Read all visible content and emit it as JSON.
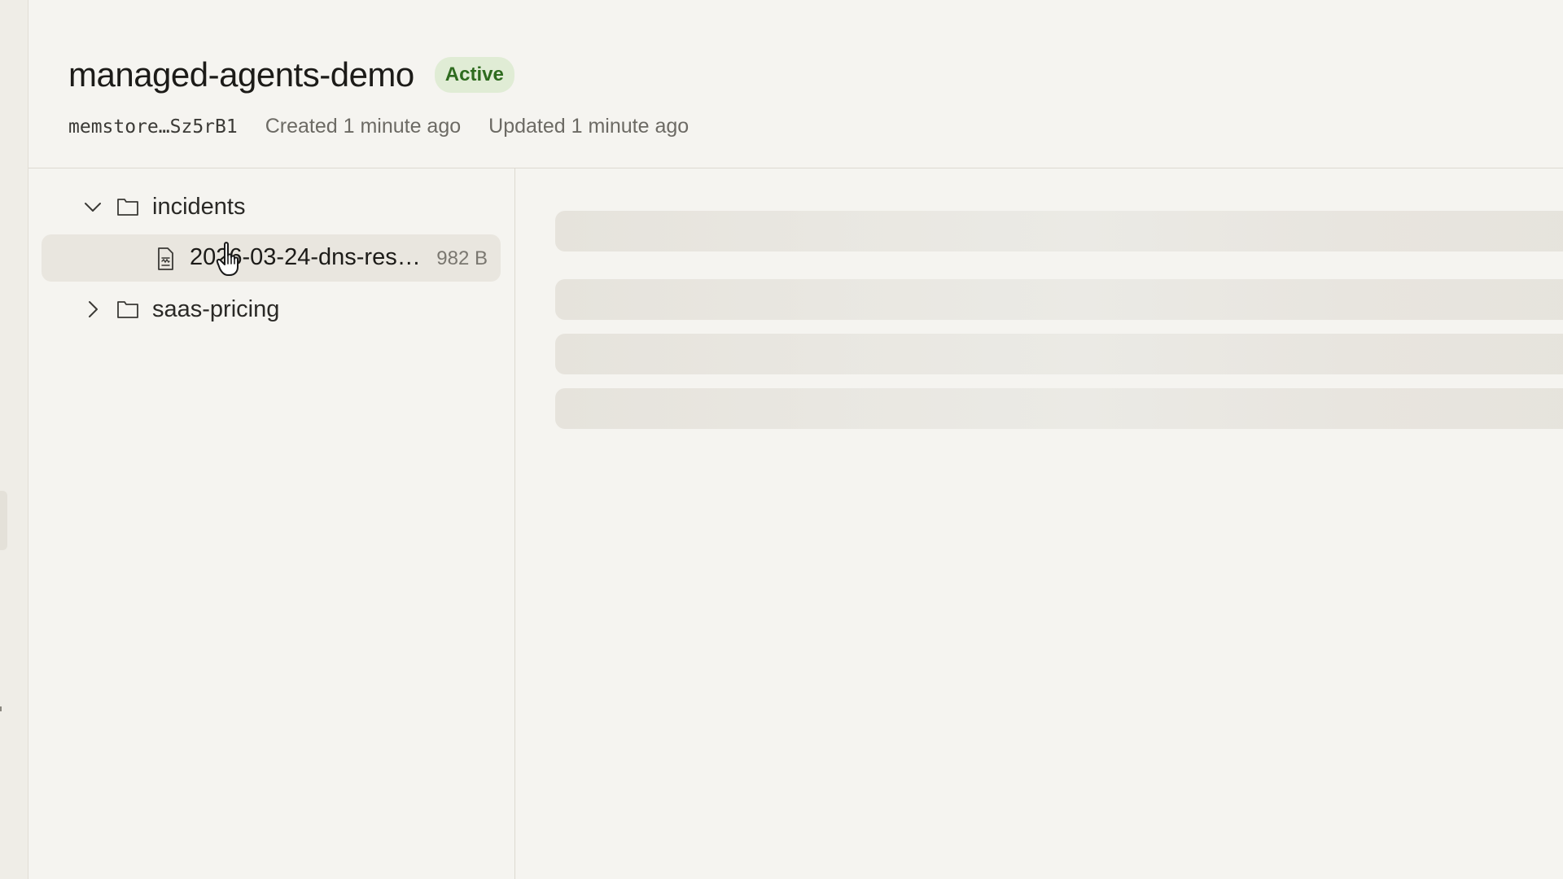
{
  "header": {
    "title": "managed-agents-demo",
    "status": "Active",
    "store_id": "memstore…Sz5rB1",
    "created": "Created 1 minute ago",
    "updated": "Updated 1 minute ago"
  },
  "tree": {
    "folders": [
      {
        "label": "incidents",
        "expanded": true,
        "icon": "folder-icon"
      },
      {
        "label": "saas-pricing",
        "expanded": false,
        "icon": "folder-icon"
      }
    ],
    "file": {
      "label": "2026-03-24-dns-res…",
      "size": "982 B",
      "icon": "document-icon"
    }
  },
  "content": {
    "state": "loading",
    "skeleton_rows": 4
  },
  "colors": {
    "background": "#f5f4f0",
    "badge_bg": "#e0ecd5",
    "badge_text": "#2e6b1f",
    "selected_row": "#e9e6df",
    "skeleton": "#e6e3dc"
  }
}
